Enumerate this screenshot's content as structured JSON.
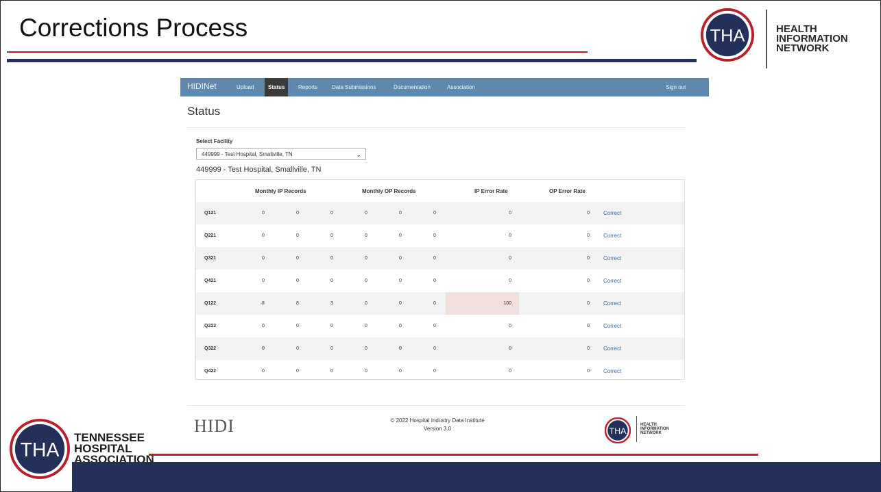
{
  "slide": {
    "title": "Corrections Process",
    "brand_line1": "HEALTH",
    "brand_line2": "INFORMATION",
    "brand_line3": "NETWORK",
    "tha_logo_text": "THA",
    "org_line1": "TENNESSEE",
    "org_line2": "HOSPITAL",
    "org_line3": "ASSOCIATION"
  },
  "colors": {
    "navy": "#22305a",
    "red": "#b8202b",
    "navbar": "#5e88ad",
    "link": "#3a6aa0",
    "error_bg": "#f3dede"
  },
  "nav": {
    "brand": "HIDINet",
    "items": [
      "Upload",
      "Status",
      "Reports",
      "Data Submissions",
      "Documentation",
      "Association"
    ],
    "active": "Status",
    "signout": "Sign out"
  },
  "page": {
    "heading": "Status",
    "select_label": "Select Facility",
    "select_value": "449999 - Test Hospital, Smallville, TN",
    "facility_heading": "449999 - Test Hospital, Smallville, TN"
  },
  "table": {
    "headers": [
      "Monthly IP Records",
      "Monthly OP Records",
      "IP Error Rate",
      "OP Error Rate"
    ],
    "action_label": "Correct",
    "rows": [
      {
        "quarter": "Q121",
        "ip": [
          "0",
          "0",
          "0"
        ],
        "op": [
          "0",
          "0",
          "0"
        ],
        "ip_err": "0",
        "op_err": "0"
      },
      {
        "quarter": "Q221",
        "ip": [
          "0",
          "0",
          "0"
        ],
        "op": [
          "0",
          "0",
          "0"
        ],
        "ip_err": "0",
        "op_err": "0"
      },
      {
        "quarter": "Q321",
        "ip": [
          "0",
          "0",
          "0"
        ],
        "op": [
          "0",
          "0",
          "0"
        ],
        "ip_err": "0",
        "op_err": "0"
      },
      {
        "quarter": "Q421",
        "ip": [
          "0",
          "0",
          "0"
        ],
        "op": [
          "0",
          "0",
          "0"
        ],
        "ip_err": "0",
        "op_err": "0"
      },
      {
        "quarter": "Q122",
        "ip": [
          "8",
          "8",
          "3"
        ],
        "op": [
          "0",
          "0",
          "0"
        ],
        "ip_err": "100",
        "op_err": "0",
        "highlight": true
      },
      {
        "quarter": "Q222",
        "ip": [
          "0",
          "0",
          "0"
        ],
        "op": [
          "0",
          "0",
          "0"
        ],
        "ip_err": "0",
        "op_err": "0"
      },
      {
        "quarter": "Q322",
        "ip": [
          "0",
          "0",
          "0"
        ],
        "op": [
          "0",
          "0",
          "0"
        ],
        "ip_err": "0",
        "op_err": "0"
      },
      {
        "quarter": "Q422",
        "ip": [
          "0",
          "0",
          "0"
        ],
        "op": [
          "0",
          "0",
          "0"
        ],
        "ip_err": "0",
        "op_err": "0"
      }
    ]
  },
  "footer": {
    "hidi_logo": "HIDI",
    "copyright": "© 2022 Hospital Industry Data Institute",
    "version": "Version 3.0",
    "small_brand_line1": "HEALTH",
    "small_brand_line2": "INFORMATION",
    "small_brand_line3": "NETWORK"
  }
}
